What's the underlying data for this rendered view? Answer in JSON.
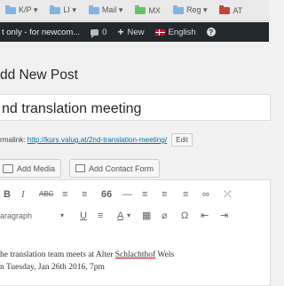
{
  "bookmarks": [
    {
      "label": "K/P ▾",
      "color": "#7fb4e3"
    },
    {
      "label": "LI ▾",
      "color": "#7fb4e3"
    },
    {
      "label": "Mail ▾",
      "color": "#7fb4e3"
    },
    {
      "label": "MX",
      "color": "#6cc06a"
    },
    {
      "label": "Reg ▾",
      "color": "#7fb4e3"
    },
    {
      "label": "AT",
      "color": "#c8433b"
    }
  ],
  "adminbar": {
    "site_title": "t only - for newcom...",
    "comments_count": "0",
    "new_label": "New",
    "language_label": "English"
  },
  "page": {
    "heading": "dd New Post"
  },
  "post": {
    "title": "nd translation meeting",
    "permalink_label": "rmalink:",
    "permalink_url": "http://kurs.valug.at/2nd-translation-meeting/",
    "edit_label": "Edit"
  },
  "media": {
    "add_media_label": "Add Media",
    "add_form_label": "Add Contact Form"
  },
  "toolbar": {
    "row1": [
      "B",
      "I",
      "ABC",
      "≡",
      "≡",
      "66",
      "—",
      "≡",
      "≡",
      "≡",
      "∞",
      "⤫"
    ],
    "row2_format": "aragraph",
    "row2": [
      "U",
      "≡",
      "A",
      "▦",
      "⌀",
      "Ω",
      "⇤",
      "⇥"
    ]
  },
  "content": {
    "line1_pre": "he translation team meets at Alter ",
    "line1_link": "Schlachthof",
    "line1_post": " Wels",
    "line2": "n Tuesday, Jan 26th 2016, 7pm"
  }
}
